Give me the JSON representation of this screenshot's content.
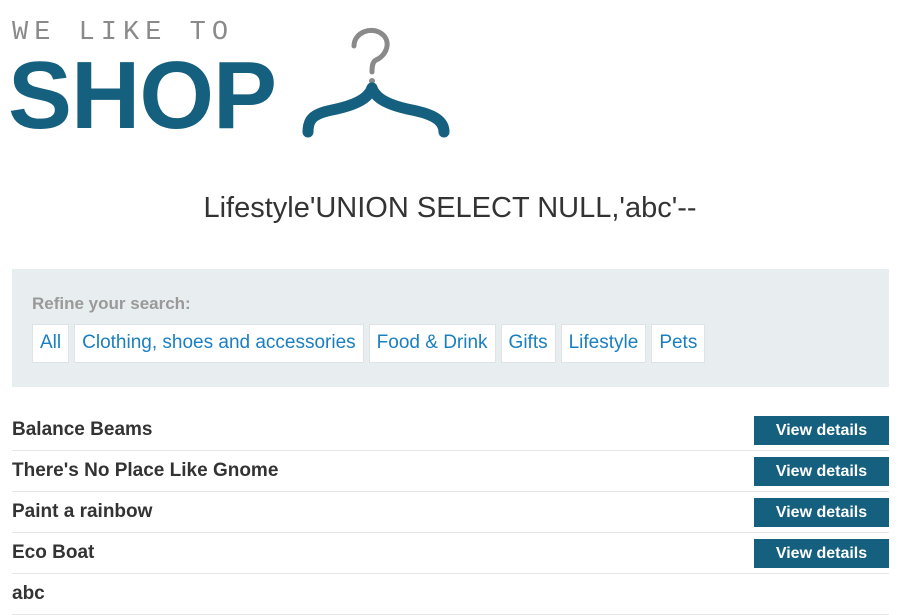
{
  "logo": {
    "tagline": "WE LIKE TO",
    "brand": "SHOP",
    "icon": "hanger-icon"
  },
  "page": {
    "heading": "Lifestyle'UNION SELECT NULL,'abc'--"
  },
  "filter": {
    "label": "Refine your search:",
    "links": [
      "All",
      "Clothing, shoes and accessories",
      "Food & Drink",
      "Gifts",
      "Lifestyle",
      "Pets"
    ]
  },
  "products": [
    {
      "name": "Balance Beams",
      "button": "View details"
    },
    {
      "name": "There's No Place Like Gnome",
      "button": "View details"
    },
    {
      "name": "Paint a rainbow",
      "button": "View details"
    },
    {
      "name": "Eco Boat",
      "button": "View details"
    },
    {
      "name": "abc",
      "button": null
    }
  ],
  "colors": {
    "brand": "#16607f",
    "link": "#1a7fc1",
    "panel": "#e8edf0"
  }
}
